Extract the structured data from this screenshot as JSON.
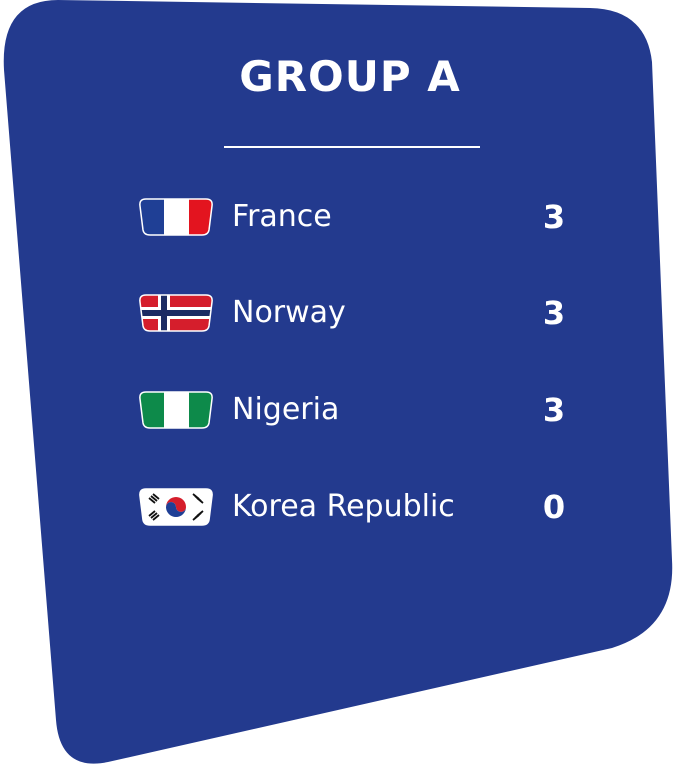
{
  "group_title": "GROUP A",
  "colors": {
    "card": "#233a8e",
    "text": "#ffffff"
  },
  "standings": [
    {
      "team": "France",
      "points": "3",
      "flag": "france-flag-icon"
    },
    {
      "team": "Norway",
      "points": "3",
      "flag": "norway-flag-icon"
    },
    {
      "team": "Nigeria",
      "points": "3",
      "flag": "nigeria-flag-icon"
    },
    {
      "team": "Korea Republic",
      "points": "0",
      "flag": "korea-republic-flag-icon"
    }
  ]
}
